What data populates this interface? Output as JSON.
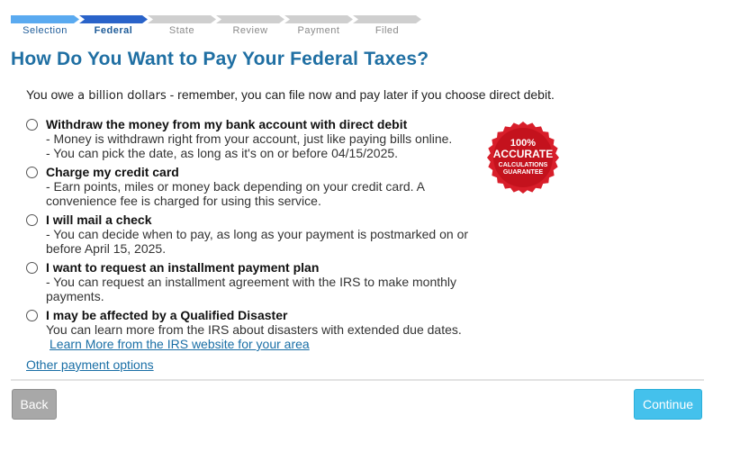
{
  "progress": {
    "steps": [
      {
        "label": "Selection",
        "state": "done"
      },
      {
        "label": "Federal",
        "state": "current"
      },
      {
        "label": "State",
        "state": "todo"
      },
      {
        "label": "Review",
        "state": "todo"
      },
      {
        "label": "Payment",
        "state": "todo"
      },
      {
        "label": "Filed",
        "state": "todo"
      }
    ]
  },
  "page": {
    "title": "How Do You Want to Pay Your Federal Taxes?",
    "owe_prefix": "You owe",
    "owe_amount": "a billion dollars",
    "owe_suffix": " - remember, you can file now and pay later if you choose direct debit."
  },
  "options": [
    {
      "title": "Withdraw the money from my bank account with direct debit",
      "lines": [
        "- Money is withdrawn right from your account, just like paying bills online.",
        "- You can pick the date, as long as it's on or before 04/15/2025."
      ]
    },
    {
      "title": "Charge my credit card",
      "lines": [
        "- Earn points, miles or money back depending on your credit card. A convenience fee is charged for using this service."
      ]
    },
    {
      "title": "I will mail a check",
      "lines": [
        "- You can decide when to pay, as long as your payment is postmarked on or before April 15, 2025."
      ]
    },
    {
      "title": "I want to request an installment payment plan",
      "lines": [
        "- You can request an installment agreement with the IRS to make monthly payments."
      ]
    },
    {
      "title": "I may be affected by a Qualified Disaster",
      "lines": [
        "You can learn more from the IRS about disasters with extended due dates."
      ],
      "link": "Learn More from the IRS website for your area"
    }
  ],
  "other_link": "Other payment options",
  "badge": {
    "line1": "100%",
    "line2": "ACCURATE",
    "line3": "CALCULATIONS",
    "line4": "GUARANTEE"
  },
  "buttons": {
    "back": "Back",
    "continue": "Continue"
  },
  "colors": {
    "accent": "#1f6fa3",
    "progress_done": "#5aaaf0",
    "progress_current": "#2a63c9",
    "progress_todo": "#cfcfcf",
    "continue": "#44c1ec",
    "back": "#a8a8a8",
    "badge": "#d81e2a"
  }
}
